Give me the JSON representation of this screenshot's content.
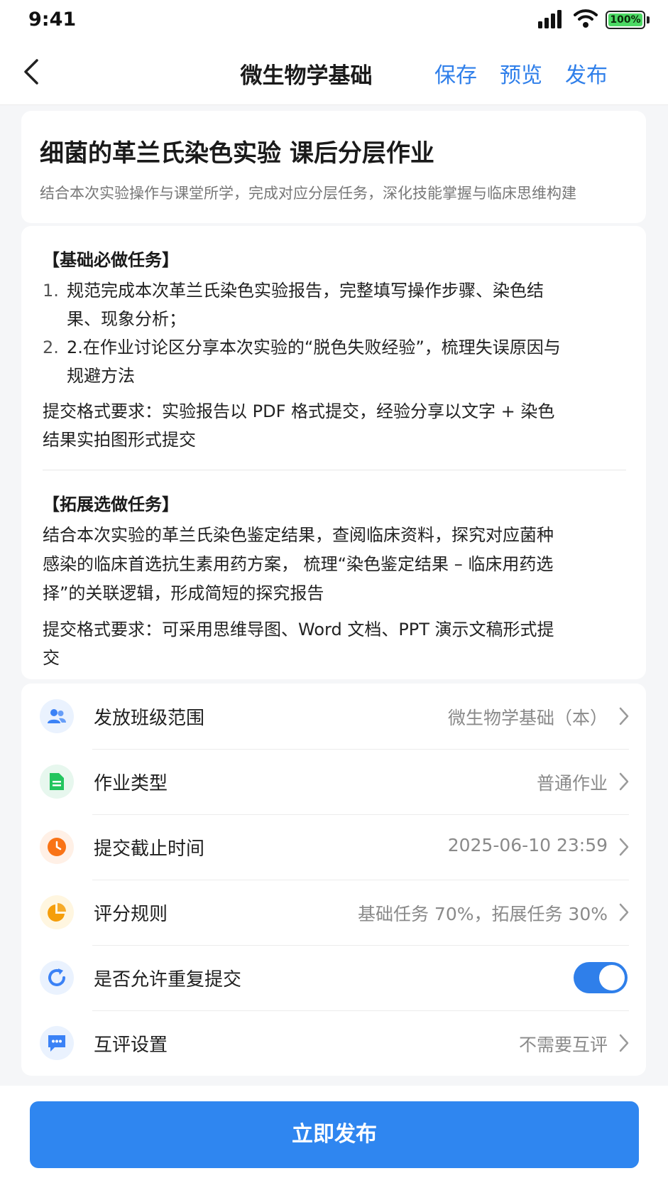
{
  "status_bar": {
    "time": "9:41",
    "battery_label": "100%"
  },
  "nav": {
    "title": "微生物学基础",
    "save_label": "保存",
    "preview_label": "预览",
    "publish_label": "发布"
  },
  "homework": {
    "title": "细菌的革兰氏染色实验 课后分层作业",
    "subtitle": "结合本次实验操作与课堂所学，完成对应分层任务，深化技能掌握与临床思维构建"
  },
  "basic_task": {
    "heading": "【基础必做任务】",
    "items": [
      {
        "num": "1.",
        "text": "规范完成本次革兰氏染色实验报告，完整填写操作步骤、染色结果、现象分析；"
      },
      {
        "num": "2.",
        "text": "2.在作业讨论区分享本次实验的“脱色失败经验”，梳理失误原因与规避方法"
      }
    ],
    "format": "提交格式要求：实验报告以 PDF 格式提交，经验分享以文字 + 染色结果实拍图形式提交"
  },
  "extension_task": {
    "heading": "【拓展选做任务】",
    "content": "结合本次实验的革兰氏染色鉴定结果，查阅临床资料，探究对应菌种感染的临床首选抗生素用药方案， 梳理“染色鉴定结果 – 临床用药选择”的关联逻辑，形成简短的探究报告",
    "format": "提交格式要求：可采用思维导图、Word 文档、PPT 演示文稿形式提交"
  },
  "settings": {
    "class_scope": {
      "label": "发放班级范围",
      "value": "微生物学基础（本）",
      "icon": "users-icon",
      "color": "#3b82f6"
    },
    "homework_type": {
      "label": "作业类型",
      "value": "普通作业",
      "icon": "document-icon",
      "color": "#22c55e"
    },
    "deadline": {
      "label": "提交截止时间",
      "value": "2025-06-10 23:59",
      "icon": "clock-icon",
      "color": "#f97316"
    },
    "grading": {
      "label": "评分规则",
      "value": "基础任务 70%，拓展任务 30%",
      "icon": "pie-chart-icon",
      "color": "#f59e0b"
    },
    "resubmit": {
      "label": "是否允许重复提交",
      "enabled": true,
      "icon": "refresh-icon",
      "color": "#3b82f6"
    },
    "peer_review": {
      "label": "互评设置",
      "value": "不需要互评",
      "icon": "chat-icon",
      "color": "#3b82f6"
    }
  },
  "publish_button": {
    "label": "立即发布"
  }
}
